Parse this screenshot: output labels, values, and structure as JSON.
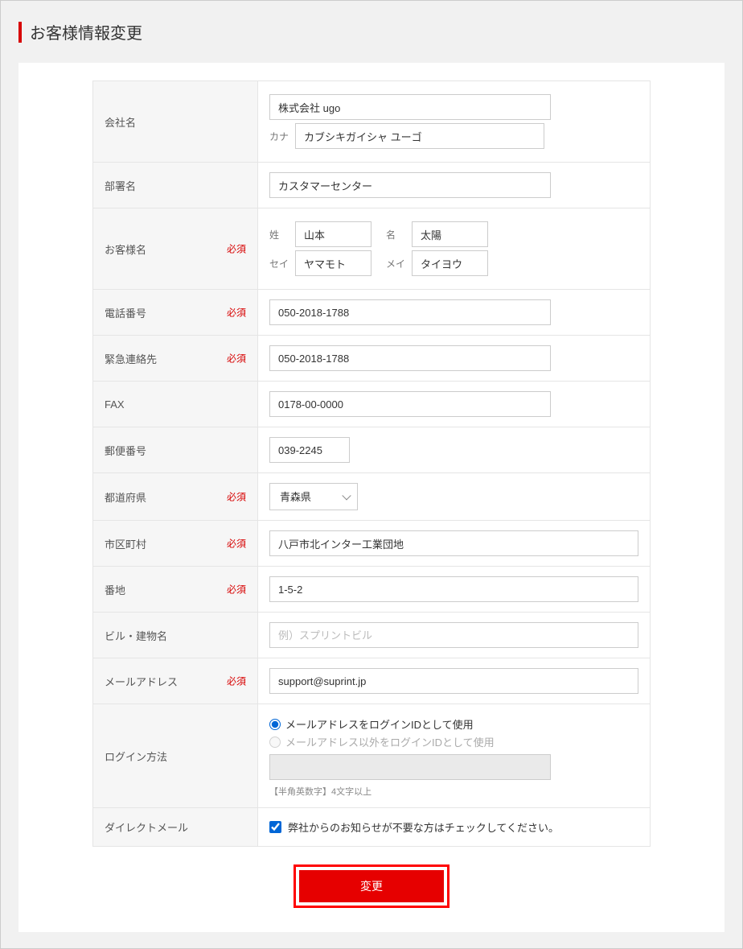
{
  "page": {
    "title": "お客様情報変更"
  },
  "labels": {
    "company": "会社名",
    "companyKana": "カナ",
    "department": "部署名",
    "customerName": "お客様名",
    "sei": "姓",
    "mei": "名",
    "seiKana": "セイ",
    "meiKana": "メイ",
    "tel": "電話番号",
    "emergency": "緊急連絡先",
    "fax": "FAX",
    "postal": "郵便番号",
    "prefecture": "都道府県",
    "city": "市区町村",
    "street": "番地",
    "building": "ビル・建物名",
    "email": "メールアドレス",
    "login": "ログイン方法",
    "dm": "ダイレクトメール",
    "required": "必須"
  },
  "values": {
    "company": "株式会社 ugo",
    "companyKana": "カブシキガイシャ ユーゴ",
    "department": "カスタマーセンター",
    "sei": "山本",
    "mei": "太陽",
    "seiKana": "ヤマモト",
    "meiKana": "タイヨウ",
    "tel": "050-2018-1788",
    "emergency": "050-2018-1788",
    "fax": "0178-00-0000",
    "postal": "039-2245",
    "prefecture": "青森県",
    "city": "八戸市北インター工業団地",
    "street": "1-5-2",
    "building": "",
    "buildingPlaceholder": "例）スプリントビル",
    "email": "support@suprint.jp",
    "loginOption1": "メールアドレスをログインIDとして使用",
    "loginOption2": "メールアドレス以外をログインIDとして使用",
    "loginId": "",
    "loginHint": "【半角英数字】4文字以上",
    "dmText": "弊社からのお知らせが不要な方はチェックしてください。"
  },
  "actions": {
    "submit": "変更"
  }
}
